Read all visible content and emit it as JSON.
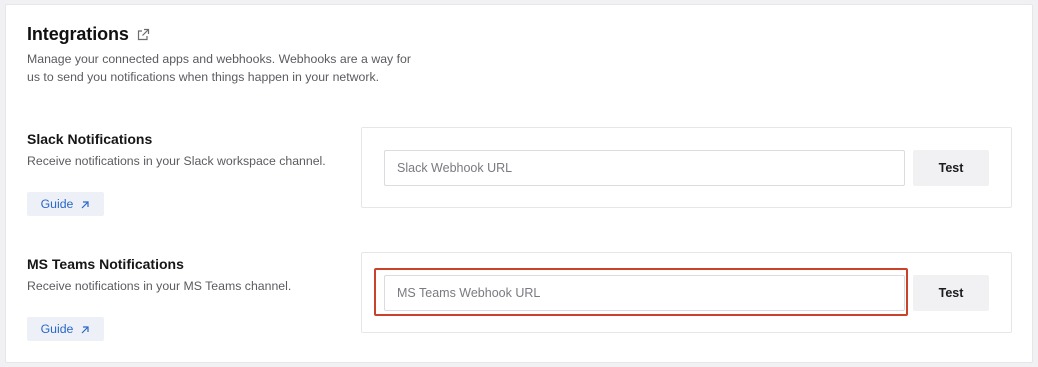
{
  "header": {
    "title": "Integrations",
    "subtitle": "Manage your connected apps and webhooks. Webhooks are a way for us to send you notifications when things happen in your network.",
    "external_link_icon": "external-link-icon"
  },
  "sections": [
    {
      "title": "Slack Notifications",
      "description": "Receive notifications in your Slack workspace channel.",
      "guide_label": "Guide",
      "input_placeholder": "Slack Webhook URL",
      "input_value": "",
      "test_label": "Test"
    },
    {
      "title": "MS Teams Notifications",
      "description": "Receive notifications in your MS Teams channel.",
      "guide_label": "Guide",
      "input_placeholder": "MS Teams Webhook URL",
      "input_value": "",
      "test_label": "Test"
    }
  ],
  "colors": {
    "accent_link": "#2a67c7",
    "highlight": "#c9432b"
  }
}
